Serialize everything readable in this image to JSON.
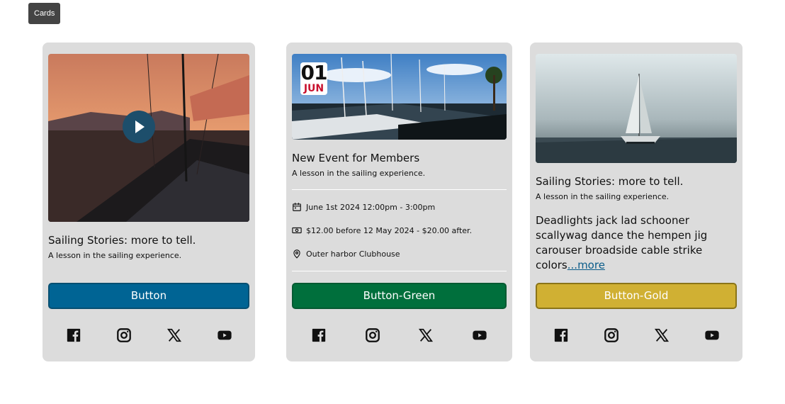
{
  "tag": "Cards",
  "cards": [
    {
      "title": "Sailing Stories: more to tell.",
      "subtitle": "A lesson in the sailing experience.",
      "button": "Button"
    },
    {
      "date_day": "01",
      "date_month": "JUN",
      "title": "New Event for Members",
      "subtitle": "A lesson in the sailing experience.",
      "when": "June 1st 2024 12:00pm - 3:00pm",
      "price": "$12.00 before 12 May 2024 - $20.00 after.",
      "location": "Outer harbor Clubhouse",
      "button": "Button-Green"
    },
    {
      "title": "Sailing Stories: more to tell.",
      "subtitle": "A lesson in the sailing experience.",
      "body": "Deadlights jack lad schooner scallywag dance the hempen jig carouser broadside cable strike colors",
      "more": "...more",
      "button": "Button-Gold"
    }
  ],
  "social_icons": [
    "facebook-icon",
    "instagram-icon",
    "x-icon",
    "youtube-icon"
  ],
  "colors": {
    "blue": "#006494",
    "green": "#006f3c",
    "gold": "#d0b033",
    "date_month": "#c8102e"
  }
}
